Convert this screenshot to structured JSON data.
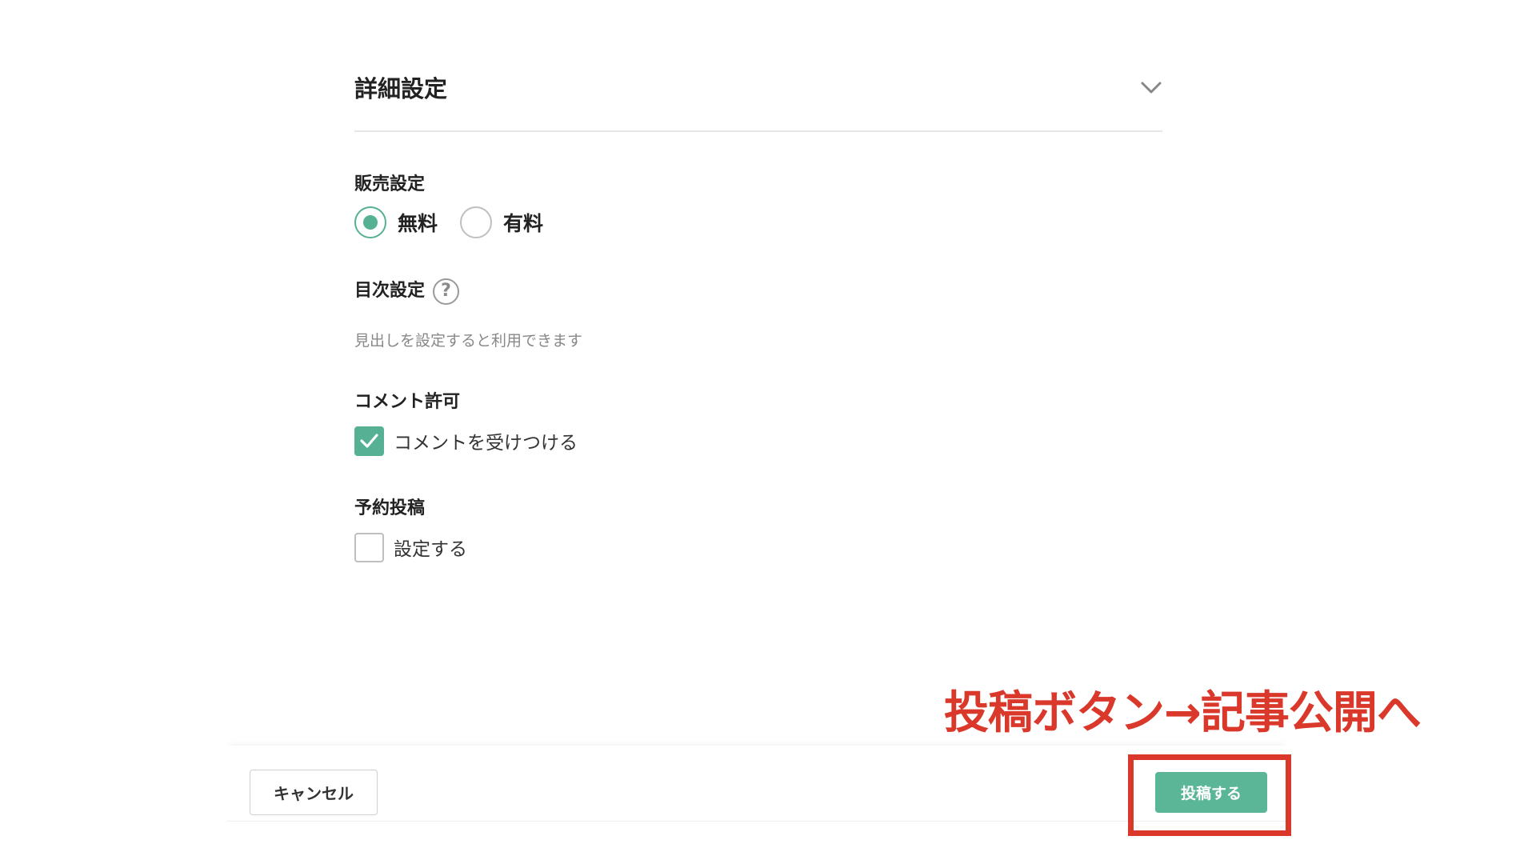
{
  "advanced_settings": {
    "title": "詳細設定",
    "toggle_icon": "chevron-down-icon"
  },
  "sales": {
    "label": "販売設定",
    "options": [
      {
        "label": "無料",
        "selected": true
      },
      {
        "label": "有料",
        "selected": false
      }
    ]
  },
  "toc": {
    "label": "目次設定",
    "help_glyph": "?",
    "hint": "見出しを設定すると利用できます"
  },
  "comments": {
    "label": "コメント許可",
    "checkbox_label": "コメントを受けつける",
    "checked": true
  },
  "schedule": {
    "label": "予約投稿",
    "checkbox_label": "設定する",
    "checked": false
  },
  "footer": {
    "cancel_label": "キャンセル",
    "publish_label": "投稿する"
  },
  "annotation": {
    "text": "投稿ボタン→記事公開へ"
  },
  "colors": {
    "accent": "#56b093",
    "annotation": "#d9382b"
  }
}
